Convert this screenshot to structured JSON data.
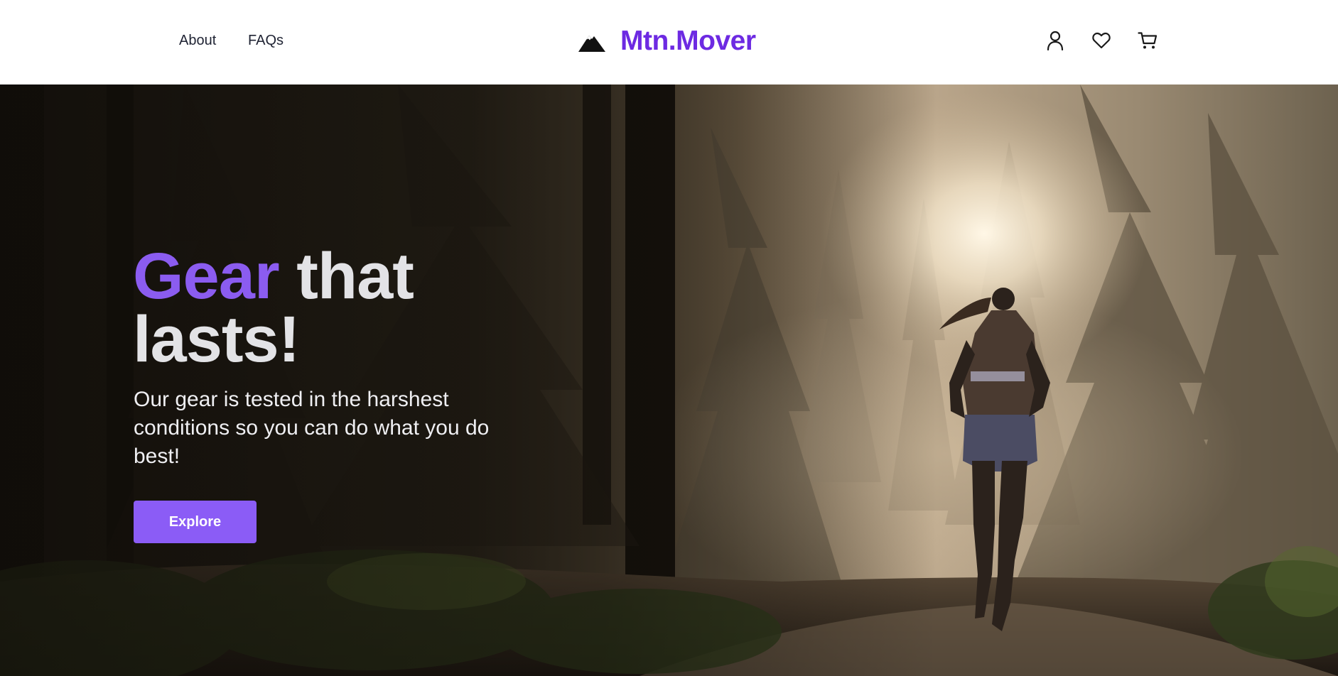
{
  "header": {
    "nav": {
      "about_label": "About",
      "faqs_label": "FAQs"
    },
    "brand": {
      "name": "Mtn.Mover",
      "logo_icon": "mountain-icon",
      "color": "#6d2ae2"
    },
    "actions": {
      "account_icon": "user-icon",
      "wishlist_icon": "heart-icon",
      "cart_icon": "cart-icon"
    }
  },
  "hero": {
    "title_accent": "Gear",
    "title_rest": " that lasts!",
    "subtitle": "Our gear is tested in the harshest conditions so you can do what you do best!",
    "cta_label": "Explore",
    "background_image": "misty forest trail with a woman running toward the sunlight",
    "colors": {
      "accent": "#8b5cf6",
      "title_text": "#e3e3e6"
    }
  }
}
